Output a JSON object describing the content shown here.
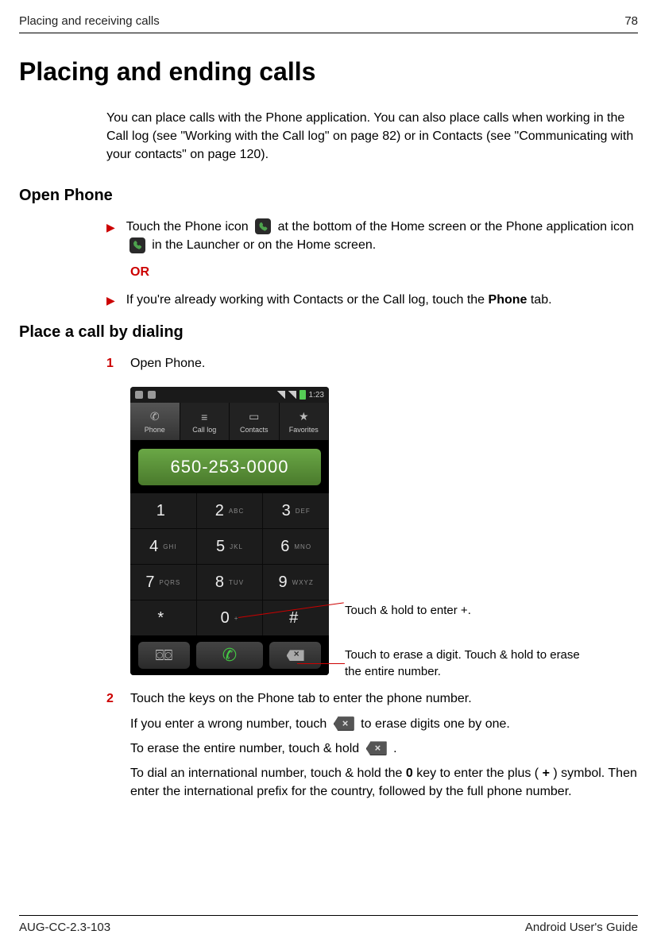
{
  "header": {
    "chapter": "Placing and receiving calls",
    "page_num": "78"
  },
  "title": "Placing and ending calls",
  "intro": "You can place calls with the Phone application. You can also place calls when working in the Call log (see \"Working with the Call log\" on page 82) or in Contacts (see \"Communicating with your contacts\" on page 120).",
  "section1": {
    "heading": "Open Phone",
    "bullet1a": "Touch the Phone icon",
    "bullet1b": "at the bottom of the Home screen or the Phone application icon",
    "bullet1c": "in the Launcher or on the Home screen.",
    "or": "OR",
    "bullet2a": "If you're already working with Contacts or the Call log, touch the ",
    "bullet2b": "Phone",
    "bullet2c": " tab."
  },
  "section2": {
    "heading": "Place a call by dialing",
    "step1": "Open Phone.",
    "callout1": "Touch & hold to enter +.",
    "callout2": "Touch to erase a digit. Touch & hold to erase the entire number.",
    "step2_line1": "Touch the keys on the Phone tab to enter the phone number.",
    "step2_line2a": "If you enter a wrong number, touch",
    "step2_line2b": "to erase digits one by one.",
    "step2_line3a": "To erase the entire number, touch & hold",
    "step2_line3b": ".",
    "step2_line4a": "To dial an international number, touch & hold the ",
    "step2_line4_bold0": "0",
    "step2_line4b": " key to enter the plus ( ",
    "step2_line4_boldplus": "+",
    "step2_line4c": " ) symbol. Then enter the international prefix for the country, followed by the full phone number."
  },
  "phone": {
    "time": "1:23",
    "tabs": [
      "Phone",
      "Call log",
      "Contacts",
      "Favorites"
    ],
    "number": "650-253-0000",
    "keys": [
      {
        "d": "1",
        "l": ""
      },
      {
        "d": "2",
        "l": "ABC"
      },
      {
        "d": "3",
        "l": "DEF"
      },
      {
        "d": "4",
        "l": "GHI"
      },
      {
        "d": "5",
        "l": "JKL"
      },
      {
        "d": "6",
        "l": "MNO"
      },
      {
        "d": "7",
        "l": "PQRS"
      },
      {
        "d": "8",
        "l": "TUV"
      },
      {
        "d": "9",
        "l": "WXYZ"
      },
      {
        "d": "*",
        "l": ""
      },
      {
        "d": "0",
        "l": "+"
      },
      {
        "d": "#",
        "l": ""
      }
    ]
  },
  "footer": {
    "doc_id": "AUG-CC-2.3-103",
    "guide": "Android User's Guide"
  }
}
